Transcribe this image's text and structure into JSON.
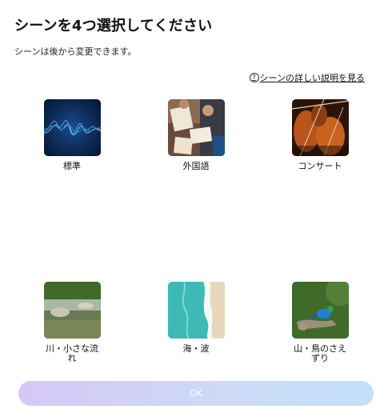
{
  "header": {
    "title": "シーンを4つ選択してください",
    "subtitle": "シーンは後から変更できます。"
  },
  "help_link": {
    "icon": "question-circle-icon",
    "label": "シーンの詳しい説明を見る"
  },
  "scenes": [
    {
      "label": "標準",
      "image": "blue-waveform"
    },
    {
      "label": "外国語",
      "image": "people-reading-books"
    },
    {
      "label": "コンサート",
      "image": "violin-players"
    },
    {
      "label": "川・小さな流れ",
      "image": "forest-stream"
    },
    {
      "label": "海・波",
      "image": "ocean-waves-beach"
    },
    {
      "label": "山・鳥のさえずり",
      "image": "bird-on-branch"
    }
  ],
  "footer": {
    "ok_label": "OK"
  },
  "colors": {
    "ok_gradient_start": "#d6c7f6",
    "ok_gradient_end": "#c3e0fa"
  }
}
